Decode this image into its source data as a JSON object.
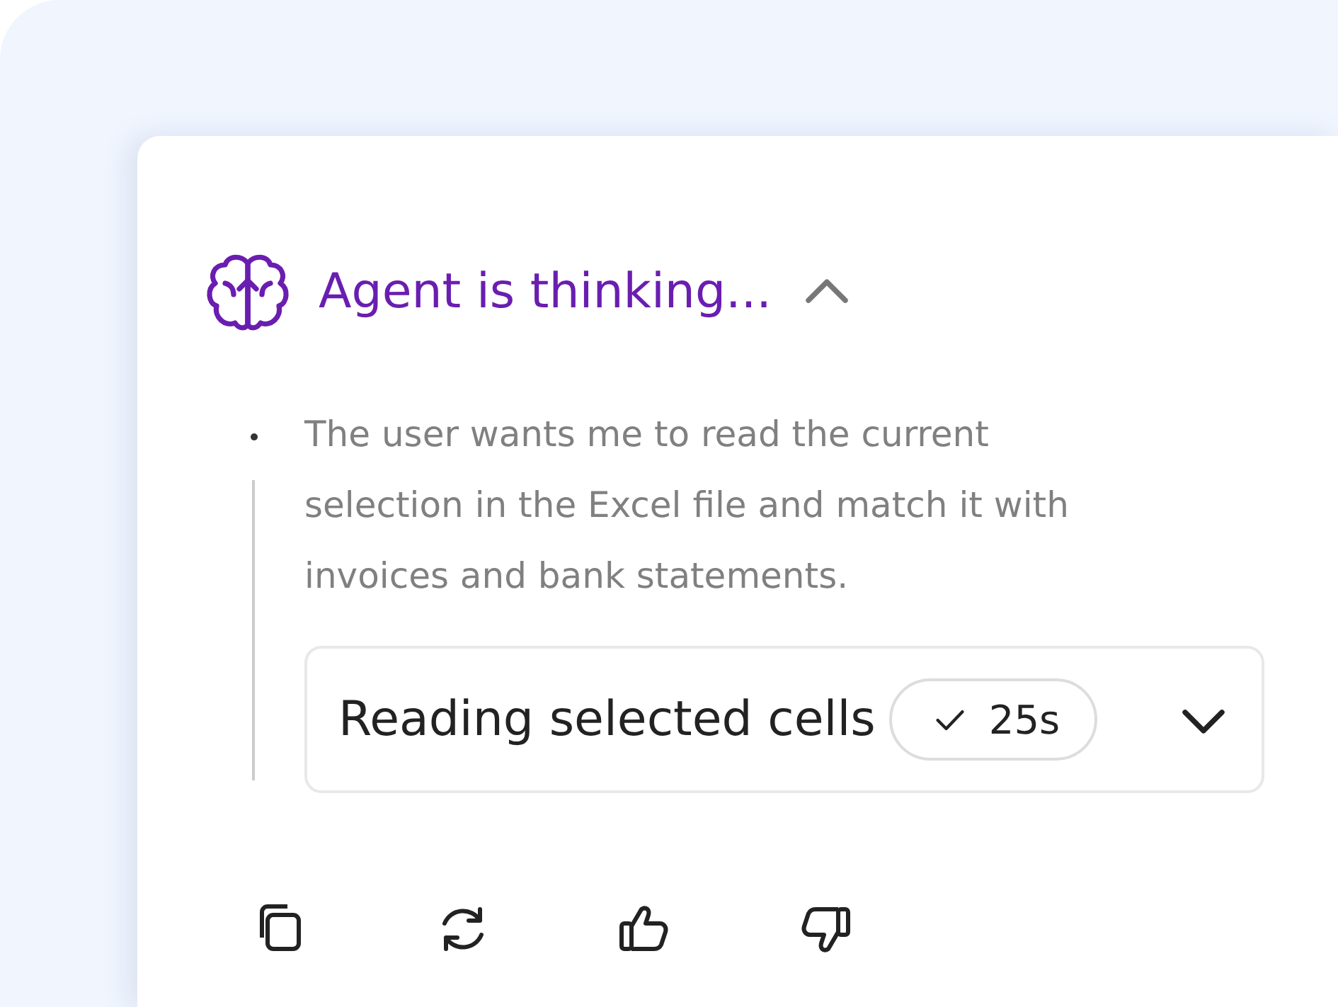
{
  "thinking": {
    "title": "Agent is thinking...",
    "expanded": true,
    "text": "The user wants me to read the current selection in the Excel file and match it with invoices and bank statements.",
    "step": {
      "label": "Reading selected cells",
      "done": true,
      "duration": "25s",
      "expanded": false
    }
  },
  "actions": [
    {
      "kind": "copy"
    },
    {
      "kind": "regenerate"
    },
    {
      "kind": "like"
    },
    {
      "kind": "dislike"
    }
  ]
}
